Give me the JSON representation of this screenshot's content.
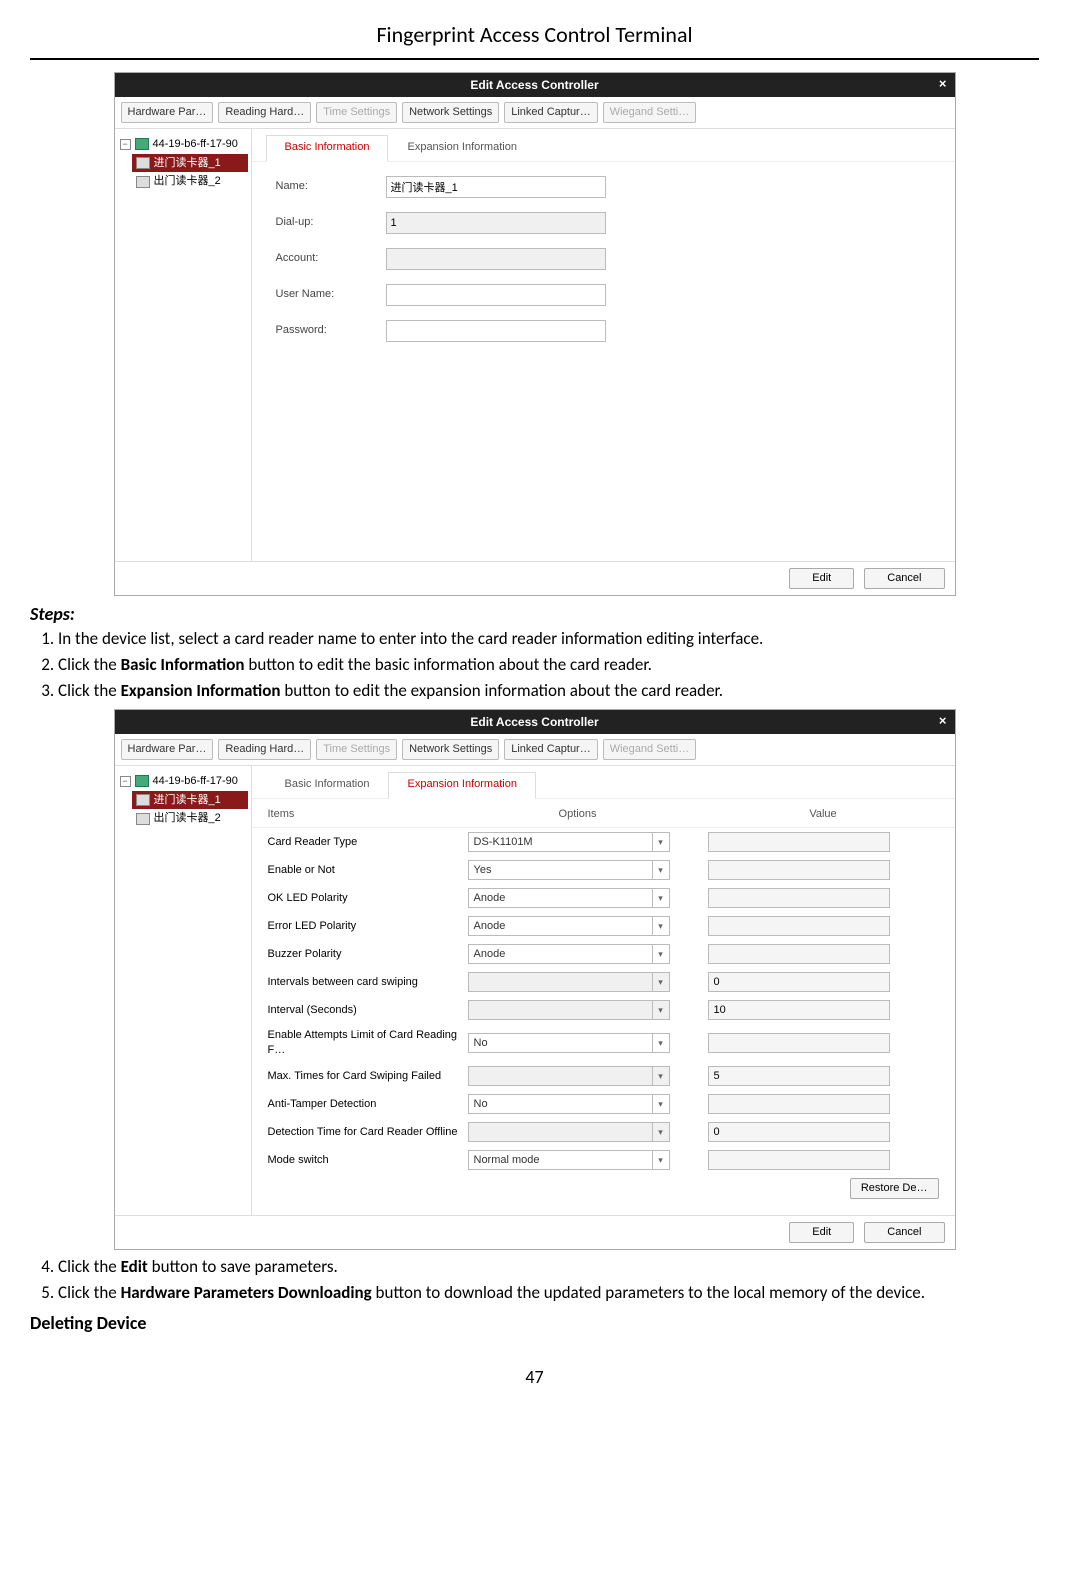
{
  "doc": {
    "title": "Fingerprint Access Control Terminal",
    "page_number": "47"
  },
  "text": {
    "steps_heading": "Steps:",
    "step1": "In the device list, select a card reader name to enter into the card reader information editing interface.",
    "step2_a": "Click the ",
    "step2_b": "Basic Information",
    "step2_c": " button to edit the basic information about the card reader.",
    "step3_a": "Click the ",
    "step3_b": "Expansion Information",
    "step3_c": " button to edit the expansion information about the card reader.",
    "step4_a": "Click the ",
    "step4_b": "Edit",
    "step4_c": " button to save parameters.",
    "step5_a": "Click the ",
    "step5_b": "Hardware Parameters Downloading",
    "step5_c": " button to download the updated parameters to the local memory of the device.",
    "deleting_heading": "Deleting Device"
  },
  "win_common": {
    "title": "Edit Access Controller",
    "close": "×",
    "toolbar": {
      "t1": "Hardware Par…",
      "t2": "Reading Hard…",
      "t3": "Time Settings",
      "t4": "Network Settings",
      "t5": "Linked Captur…",
      "t6": "Wiegand Setti…"
    },
    "tree": {
      "root": "44-19-b6-ff-17-90",
      "child1": "进门读卡器_1",
      "child2": "出门读卡器_2"
    },
    "subtab_basic": "Basic Information",
    "subtab_exp": "Expansion Information",
    "footer_edit": "Edit",
    "footer_cancel": "Cancel"
  },
  "win1_form": {
    "name_label": "Name:",
    "name_value": "进门读卡器_1",
    "dial_label": "Dial-up:",
    "dial_value": "1",
    "account_label": "Account:",
    "user_label": "User Name:",
    "pwd_label": "Password:"
  },
  "win2": {
    "header_items": "Items",
    "header_options": "Options",
    "header_value": "Value",
    "restore": "Restore De…",
    "rows": [
      {
        "item": "Card Reader Type",
        "option": "DS-K1101M",
        "opt_enabled": true,
        "value": ""
      },
      {
        "item": "Enable or Not",
        "option": "Yes",
        "opt_enabled": true,
        "value": ""
      },
      {
        "item": "OK LED Polarity",
        "option": "Anode",
        "opt_enabled": true,
        "value": ""
      },
      {
        "item": "Error LED Polarity",
        "option": "Anode",
        "opt_enabled": true,
        "value": ""
      },
      {
        "item": "Buzzer Polarity",
        "option": "Anode",
        "opt_enabled": true,
        "value": ""
      },
      {
        "item": "Intervals between card swiping",
        "option": "",
        "opt_enabled": false,
        "value": "0"
      },
      {
        "item": "Interval (Seconds)",
        "option": "",
        "opt_enabled": false,
        "value": "10"
      },
      {
        "item": "Enable Attempts Limit of Card Reading F…",
        "option": "No",
        "opt_enabled": true,
        "value": ""
      },
      {
        "item": "Max. Times for Card Swiping Failed",
        "option": "",
        "opt_enabled": false,
        "value": "5"
      },
      {
        "item": "Anti-Tamper Detection",
        "option": "No",
        "opt_enabled": true,
        "value": ""
      },
      {
        "item": "Detection Time for Card Reader Offline",
        "option": "",
        "opt_enabled": false,
        "value": "0"
      },
      {
        "item": "Mode switch",
        "option": "Normal mode",
        "opt_enabled": true,
        "value": ""
      }
    ]
  }
}
